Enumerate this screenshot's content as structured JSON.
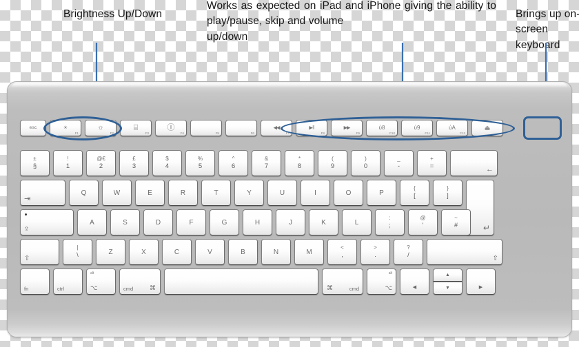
{
  "annotations": {
    "brightness": "Brightness Up/Down",
    "media": "Works as expected on iPad and iPhone giving the ability to play/pause, skip and volume",
    "media_last": "up/down",
    "keyboard": "Brings up on-screen keyboard"
  },
  "colors": {
    "highlight": "#2f6096",
    "arrow": "#3a6fb0",
    "key_text": "#6d6d6d",
    "body_top": "#d2d2d2"
  },
  "keyboard": {
    "layout": "Apple Wireless Keyboard (UK)",
    "fn_row": [
      {
        "name": "esc",
        "label": "esc",
        "fnum": "",
        "type": "text"
      },
      {
        "name": "brightness-down",
        "label": "☀",
        "fnum": "F1",
        "type": "glyph"
      },
      {
        "name": "brightness-up",
        "label": "☼",
        "fnum": "F2",
        "type": "glyph"
      },
      {
        "name": "expose",
        "label": "⌸",
        "fnum": "F3",
        "type": "glyph"
      },
      {
        "name": "dashboard",
        "label": "Ⓘ",
        "fnum": "F4",
        "type": "glyph"
      },
      {
        "name": "f5",
        "label": "",
        "fnum": "F5",
        "type": "glyph"
      },
      {
        "name": "f6",
        "label": "",
        "fnum": "F6",
        "type": "glyph"
      },
      {
        "name": "rewind",
        "label": "◀◀",
        "fnum": "F7",
        "type": "glyph"
      },
      {
        "name": "play-pause",
        "label": "▶‖",
        "fnum": "F8",
        "type": "glyph"
      },
      {
        "name": "fast-forward",
        "label": "▶▶",
        "fnum": "F9",
        "type": "glyph"
      },
      {
        "name": "mute",
        "label": "ὐ8",
        "fnum": "F10",
        "type": "glyph"
      },
      {
        "name": "volume-down",
        "label": "ὐ9",
        "fnum": "F11",
        "type": "glyph"
      },
      {
        "name": "volume-up",
        "label": "ὐA",
        "fnum": "F12",
        "type": "glyph"
      },
      {
        "name": "eject",
        "label": "⏏",
        "fnum": "",
        "type": "glyph"
      }
    ],
    "number_row": [
      {
        "name": "section",
        "up": "±",
        "dn": "§"
      },
      {
        "name": "one",
        "up": "!",
        "dn": "1"
      },
      {
        "name": "two",
        "up": "@€",
        "dn": "2"
      },
      {
        "name": "three",
        "up": "£",
        "dn": "3"
      },
      {
        "name": "four",
        "up": "$",
        "dn": "4"
      },
      {
        "name": "five",
        "up": "%",
        "dn": "5"
      },
      {
        "name": "six",
        "up": "^",
        "dn": "6"
      },
      {
        "name": "seven",
        "up": "&",
        "dn": "7"
      },
      {
        "name": "eight",
        "up": "*",
        "dn": "8"
      },
      {
        "name": "nine",
        "up": "(",
        "dn": "9"
      },
      {
        "name": "zero",
        "up": ")",
        "dn": "0"
      },
      {
        "name": "minus",
        "up": "_",
        "dn": "-"
      },
      {
        "name": "equals",
        "up": "+",
        "dn": "="
      },
      {
        "name": "delete",
        "up": "",
        "dn": "←"
      }
    ],
    "qwerty_row": {
      "tab": "⇥",
      "keys": [
        "Q",
        "W",
        "E",
        "R",
        "T",
        "Y",
        "U",
        "I",
        "O",
        "P"
      ],
      "bracket_left": {
        "up": "{",
        "dn": "["
      },
      "bracket_right": {
        "up": "}",
        "dn": "]"
      },
      "enter": "↵"
    },
    "home_row": {
      "caps": "⇪",
      "keys": [
        "A",
        "S",
        "D",
        "F",
        "G",
        "H",
        "J",
        "K",
        "L"
      ],
      "semicolon": {
        "up": ":",
        "dn": ";"
      },
      "quote": {
        "up": "@",
        "dn": "'"
      },
      "hash": {
        "up": "~",
        "dn": "#"
      }
    },
    "shift_row": {
      "shift_left": "⇧",
      "backslash": {
        "up": "|",
        "dn": "\\"
      },
      "keys": [
        "Z",
        "X",
        "C",
        "V",
        "B",
        "N",
        "M"
      ],
      "comma": {
        "up": "<",
        "dn": ","
      },
      "period": {
        "up": ">",
        "dn": "."
      },
      "slash": {
        "up": "?",
        "dn": "/"
      },
      "shift_right": "⇧"
    },
    "bottom_row": {
      "fn": "fn",
      "ctrl": "ctrl",
      "alt_left_top": "alt",
      "alt_left_sym": "⌥",
      "cmd_left_label": "cmd",
      "cmd_left_sym": "⌘",
      "space": "",
      "cmd_right_sym": "⌘",
      "cmd_right_label": "cmd",
      "alt_right_top": "alt",
      "alt_right_sym": "⌥",
      "arrow_left": "◀",
      "arrow_up": "▲",
      "arrow_down": "▼",
      "arrow_right": "▶"
    }
  }
}
